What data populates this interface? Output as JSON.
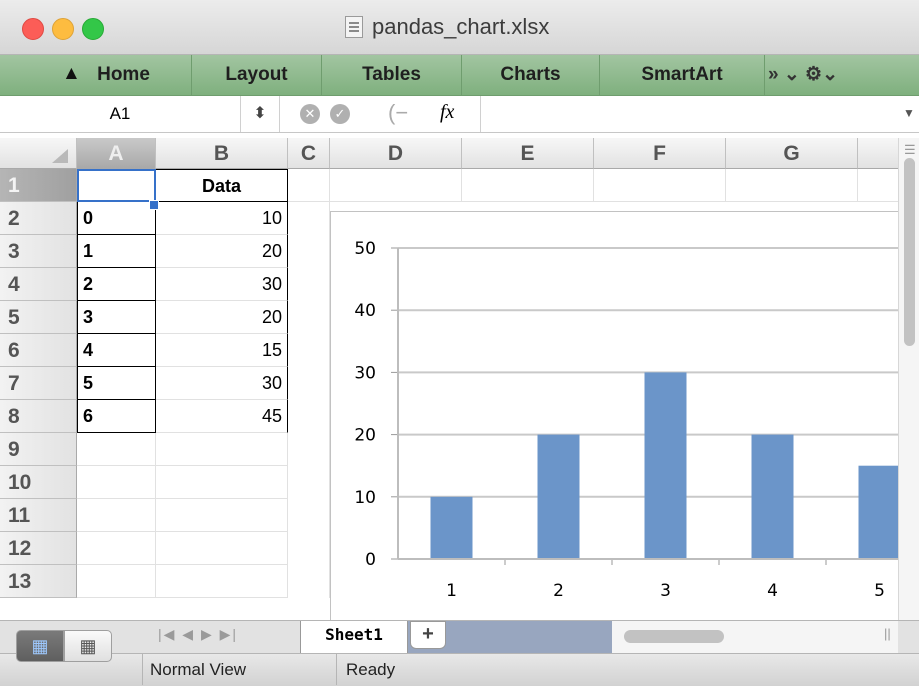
{
  "window": {
    "title": "pandas_chart.xlsx"
  },
  "ribbon": {
    "tabs": [
      {
        "label": "Home"
      },
      {
        "label": "Layout"
      },
      {
        "label": "Tables"
      },
      {
        "label": "Charts"
      },
      {
        "label": "SmartArt"
      }
    ],
    "more_glyph": "»  ⌄  ⚙⌄"
  },
  "formula_bar": {
    "name_box": "A1",
    "stepper": "⬍",
    "fx_label": "fx",
    "formula_value": ""
  },
  "grid": {
    "columns": [
      "A",
      "B",
      "C",
      "D",
      "E",
      "F",
      "G"
    ],
    "rows": [
      "1",
      "2",
      "3",
      "4",
      "5",
      "6",
      "7",
      "8",
      "9",
      "10",
      "11",
      "12",
      "13"
    ],
    "selected_cell": "A1",
    "header_b1": "Data",
    "table": [
      {
        "index": "0",
        "value": "10"
      },
      {
        "index": "1",
        "value": "20"
      },
      {
        "index": "2",
        "value": "30"
      },
      {
        "index": "3",
        "value": "20"
      },
      {
        "index": "4",
        "value": "15"
      },
      {
        "index": "5",
        "value": "30"
      },
      {
        "index": "6",
        "value": "45"
      }
    ]
  },
  "chart_data": {
    "type": "bar",
    "categories": [
      "1",
      "2",
      "3",
      "4",
      "5"
    ],
    "values": [
      10,
      20,
      30,
      20,
      15
    ],
    "ylim": [
      0,
      50
    ],
    "yticks": [
      "0",
      "10",
      "20",
      "30",
      "40",
      "50"
    ],
    "grid": true,
    "bar_color": "#6b95c9"
  },
  "sheets": {
    "tabs": [
      {
        "label": "Sheet1"
      }
    ],
    "add_label": "+",
    "nav_glyphs": "|◀ ◀ ▶ ▶|"
  },
  "status": {
    "view": "Normal View",
    "state": "Ready"
  }
}
